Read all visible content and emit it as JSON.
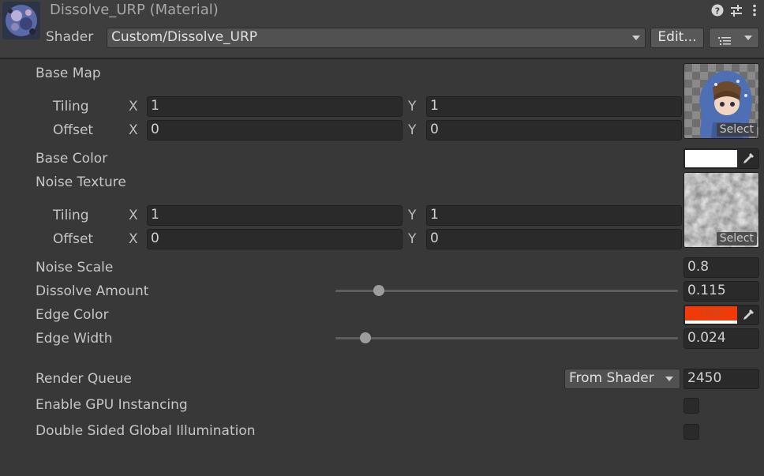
{
  "header": {
    "title": "Dissolve_URP (Material)",
    "shader_label": "Shader",
    "shader_value": "Custom/Dissolve_URP",
    "edit_label": "Edit..."
  },
  "properties": {
    "base_map": {
      "label": "Base Map",
      "tiling_label": "Tiling",
      "offset_label": "Offset",
      "tiling_x": "1",
      "tiling_y": "1",
      "offset_x": "0",
      "offset_y": "0",
      "select_label": "Select"
    },
    "base_color": {
      "label": "Base Color",
      "color": "#ffffff"
    },
    "noise_texture": {
      "label": "Noise Texture",
      "tiling_label": "Tiling",
      "offset_label": "Offset",
      "tiling_x": "1",
      "tiling_y": "1",
      "offset_x": "0",
      "offset_y": "0",
      "select_label": "Select"
    },
    "noise_scale": {
      "label": "Noise Scale",
      "value": "0.8"
    },
    "dissolve_amount": {
      "label": "Dissolve Amount",
      "value": "0.115",
      "fraction": 0.127
    },
    "edge_color": {
      "label": "Edge Color",
      "color": "#f03a08",
      "hdr_label": "HDR"
    },
    "edge_width": {
      "label": "Edge Width",
      "value": "0.024",
      "fraction": 0.088
    }
  },
  "advanced": {
    "render_queue_label": "Render Queue",
    "render_queue_mode": "From Shader",
    "render_queue_value": "2450",
    "gpu_instancing_label": "Enable GPU Instancing",
    "gpu_instancing": false,
    "double_sided_gi_label": "Double Sided Global Illumination",
    "double_sided_gi": false
  },
  "axis": {
    "x": "X",
    "y": "Y"
  },
  "icons": [
    "help-icon",
    "preset-sliders-icon",
    "more-vertical-icon",
    "list-icon",
    "chevron-down-icon",
    "eyedropper-icon"
  ]
}
